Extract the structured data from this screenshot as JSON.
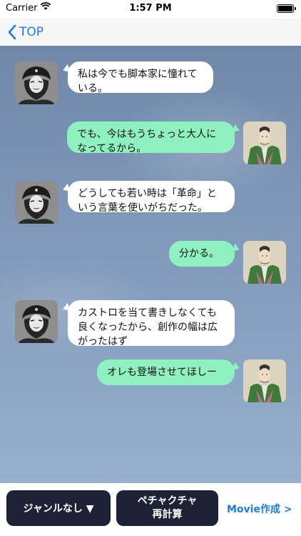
{
  "status_bar": {
    "carrier": "Carrier",
    "time": "1:57 PM"
  },
  "nav": {
    "back_label": "TOP"
  },
  "messages": [
    {
      "side": "left",
      "speaker": "che-guevara",
      "text": "私は今でも脚本家に憧れている。"
    },
    {
      "side": "right",
      "speaker": "samurai-lord",
      "text": "でも、今はもうちょっと大人になってるから。"
    },
    {
      "side": "left",
      "speaker": "che-guevara",
      "text": "どうしても若い時は「革命」という言葉を使いがちだった。"
    },
    {
      "side": "right",
      "speaker": "samurai-lord",
      "text": "分かる。"
    },
    {
      "side": "left",
      "speaker": "che-guevara",
      "text": "カストロを当て書きしなくても良くなったから、創作の幅は広がったはず"
    },
    {
      "side": "right",
      "speaker": "samurai-lord",
      "text": "オレも登場させてほしー"
    }
  ],
  "toolbar": {
    "genre_label": "ジャンルなし ▼",
    "recalc_line1": "ペチャクチャ",
    "recalc_line2": "再計算",
    "movie_label": "Movie作成 >"
  },
  "colors": {
    "accent": "#1a7cf3",
    "toolbar_button_bg": "#1f2236",
    "bubble_right": "#8ff0c0",
    "bubble_left": "#ffffff"
  }
}
